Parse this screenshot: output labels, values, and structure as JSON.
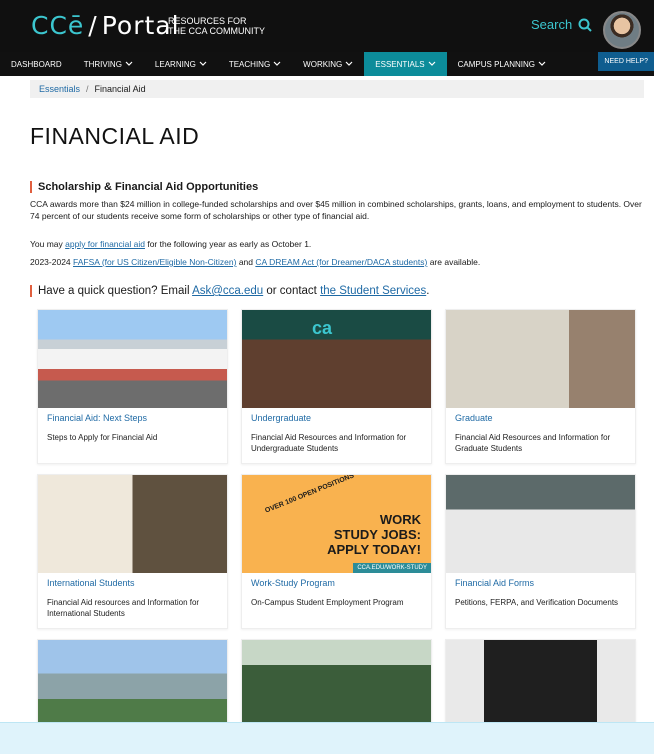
{
  "header": {
    "logo_left": "CCē",
    "logo_slash": "/",
    "logo_portal": "Portal",
    "tagline_line1": "RESOURCES FOR",
    "tagline_line2": "THE CCA COMMUNITY",
    "search_label": "Search",
    "need_help": "NEED HELP?"
  },
  "nav": [
    {
      "label": "DASHBOARD",
      "has_chevron": false,
      "active": false
    },
    {
      "label": "THRIVING",
      "has_chevron": true,
      "active": false
    },
    {
      "label": "LEARNING",
      "has_chevron": true,
      "active": false
    },
    {
      "label": "TEACHING",
      "has_chevron": true,
      "active": false
    },
    {
      "label": "WORKING",
      "has_chevron": true,
      "active": false
    },
    {
      "label": "ESSENTIALS",
      "has_chevron": true,
      "active": true
    },
    {
      "label": "CAMPUS PLANNING",
      "has_chevron": true,
      "active": false
    }
  ],
  "breadcrumb": {
    "item1": "Essentials",
    "sep": "/",
    "item2": "Financial Aid"
  },
  "page": {
    "title": "FINANCIAL AID",
    "section_title": "Scholarship & Financial Aid Opportunities",
    "intro": "CCA awards more than $24 million in college-funded scholarships and over $45 million in combined scholarships, grants, loans, and employment to students. Over 74 percent of our students receive some form of scholarships or other type of financial aid.",
    "apply_prefix": "You may ",
    "apply_link": "apply for financial aid",
    "apply_suffix": " for the following year as early as October 1.",
    "fafsa_prefix": "2023-2024 ",
    "fafsa_link": "FAFSA (for US Citizen/Eligible Non-Citizen)",
    "fafsa_mid": " and ",
    "dream_link": "CA DREAM Act (for Dreamer/DACA students)",
    "fafsa_suffix": " are available.",
    "question_prefix": "Have a quick question? Email ",
    "email_link": "Ask@cca.edu",
    "question_mid": " or contact ",
    "services_link": "the Student Services",
    "question_suffix": "."
  },
  "cards": [
    {
      "title": "Financial Aid: Next Steps",
      "desc": "Steps to Apply for Financial Aid"
    },
    {
      "title": "Undergraduate",
      "desc": "Financial Aid Resources and Information for Undergraduate Students"
    },
    {
      "title": "Graduate",
      "desc": "Financial Aid Resources and Information for Graduate Students"
    },
    {
      "title": "International Students",
      "desc": "Financial Aid resources and Information for International Students"
    },
    {
      "title": "Work-Study Program",
      "desc": "On-Campus Student Employment Program"
    },
    {
      "title": "Financial Aid Forms",
      "desc": "Petitions, FERPA, and Verification Documents"
    }
  ],
  "work_card_art": {
    "open_positions": "OVER 100 OPEN POSITIONS",
    "line1": "WORK",
    "line2": "STUDY JOBS:",
    "line3": "APPLY TODAY!",
    "url": "CCA.EDU/WORK-STUDY"
  },
  "ca_mark": "ca",
  "colors": {
    "accent": "#3cc6cf",
    "nav_active": "#0c8c9a",
    "link": "#1f6aa5",
    "section_bar": "#e05f3f"
  }
}
